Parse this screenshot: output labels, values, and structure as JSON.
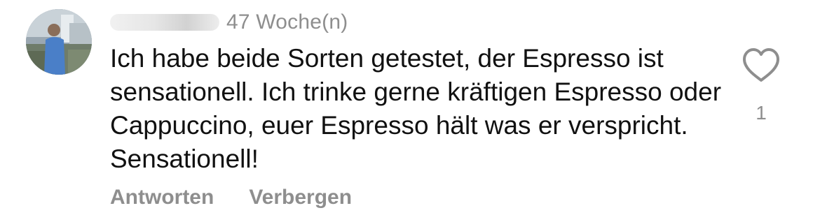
{
  "comment": {
    "timestamp": "47 Woche(n)",
    "text": "Ich habe beide Sorten getestet, der Espresso ist sensationell. Ich trinke gerne kräftigen Espresso oder Cappuccino, euer Espresso hält was er verspricht. Sensationell!",
    "actions": {
      "reply_label": "Antworten",
      "hide_label": "Verbergen"
    },
    "like": {
      "icon": "heart-outline-icon",
      "count": "1"
    },
    "avatar": {
      "icon": "avatar-photo"
    }
  },
  "colors": {
    "text_primary": "#111111",
    "text_secondary": "#8e8e8e",
    "background": "#ffffff"
  }
}
